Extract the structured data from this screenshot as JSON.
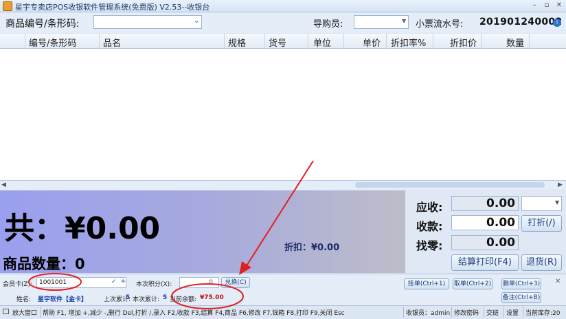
{
  "window": {
    "title": "星宇专卖店POS收银软件管理系统(免费版) V2.53--收银台",
    "controls": [
      "minimize-icon",
      "restore-icon",
      "close-icon"
    ]
  },
  "toolbar": {
    "code_label": "商品编号/条形码:",
    "code_value": "",
    "guide_label": "导购员:",
    "guide_value": "",
    "receipt_label": "小票流水号:",
    "receipt_number": "201901240002"
  },
  "table": {
    "columns": [
      "编号/条形码",
      "品名",
      "规格",
      "货号",
      "单位",
      "单价",
      "折扣率%",
      "折扣价",
      "数量"
    ],
    "rows": []
  },
  "summary": {
    "total": "共：¥0.00",
    "quantity": "商品数量：0",
    "discount": "折扣：¥0.00"
  },
  "payment": {
    "due_label": "应收:",
    "due_value": "0.00",
    "received_label": "收款:",
    "received_value": "0.00",
    "change_label": "找零:",
    "change_value": "0.00",
    "discount_button": "打折(/)",
    "checkout_button": "结算打印(F4)",
    "return_button": "退货(R)"
  },
  "member": {
    "card_label": "会员卡(Z):",
    "card_value": "1001001",
    "points_label": "本次积分(X):",
    "points_value": "0",
    "redeem_button": "兑换(C)",
    "name_label": "姓名:",
    "name_value": "星宇软件【金卡】",
    "last_total_label": "上次累计:",
    "last_total_value": "5",
    "this_total_label": "本次累计:",
    "this_total_value": "5",
    "balance_label": "当前余额:",
    "balance_value": "¥75.00"
  },
  "order_buttons": {
    "hang": "挂单(Ctrl+1)",
    "take": "取单(Ctrl+2)",
    "delete": "删单(Ctrl+3)",
    "note": "备注(Ctrl+B)"
  },
  "statusbar": {
    "zoom": "放大窗口",
    "help": "帮助 F1, 增加 +,减少 -,删行 Del,打折 /,录入 F2,收款 F3,结算 F4,商品 F6,修改 F7,钱箱 F8,打印 F9,关闭 Esc",
    "cashier": "收银员：admin",
    "change_password": "修改密码",
    "shift": "交班",
    "settings": "设置",
    "stock": "当前库存:20"
  },
  "colors": {
    "summary_gradient_start": "#9a9fee",
    "summary_gradient_end": "#bdbdc9",
    "balance_red": "#c01010",
    "annotation_red": "#e02020"
  }
}
